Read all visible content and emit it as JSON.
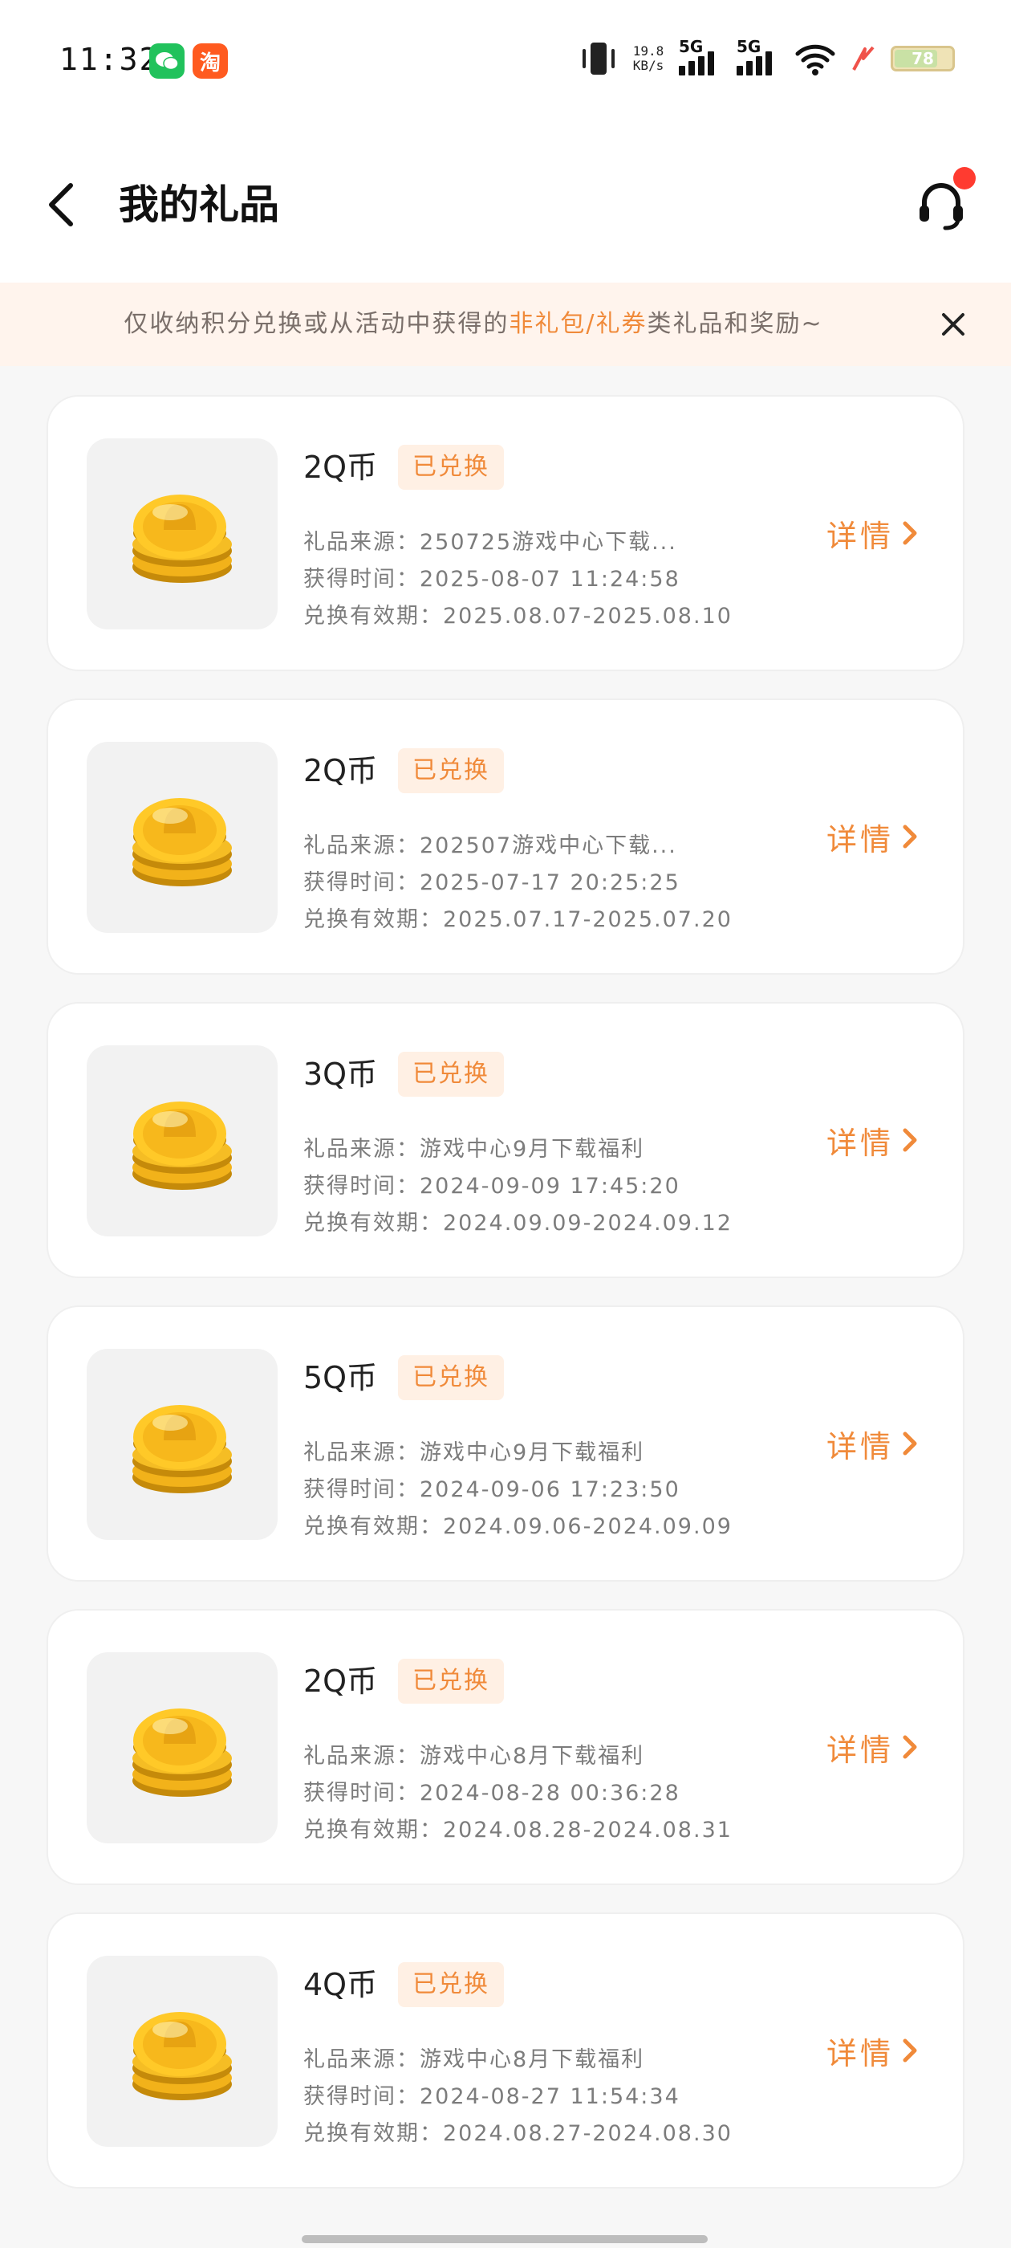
{
  "status_bar": {
    "time": "11:32",
    "net_speed_value": "19.8",
    "net_speed_unit": "KB/s",
    "sim1_label": "5G",
    "sim2_label": "5G",
    "battery_level": "78",
    "app_icons": [
      "wechat-icon",
      "taobao-icon"
    ],
    "taobao_glyph": "淘"
  },
  "header": {
    "title": "我的礼品",
    "back_icon": "chevron-left-icon",
    "support_icon": "headset-icon"
  },
  "notice": {
    "text_before": "仅收纳积分兑换或从活动中获得的",
    "text_highlight": "非礼包/礼券",
    "text_after": "类礼品和奖励~",
    "close_icon": "close-icon"
  },
  "labels": {
    "source": "礼品来源",
    "obtained": "获得时间",
    "validity": "兑换有效期",
    "colon": "：",
    "detail": "详情"
  },
  "gifts": [
    {
      "name": "2Q币",
      "status": "已兑换",
      "source": "250725游戏中心下载...",
      "obtained": "2025-08-07 11:24:58",
      "validity": "2025.08.07-2025.08.10"
    },
    {
      "name": "2Q币",
      "status": "已兑换",
      "source": "202507游戏中心下载...",
      "obtained": "2025-07-17 20:25:25",
      "validity": "2025.07.17-2025.07.20"
    },
    {
      "name": "3Q币",
      "status": "已兑换",
      "source": "游戏中心9月下载福利",
      "obtained": "2024-09-09 17:45:20",
      "validity": "2024.09.09-2024.09.12"
    },
    {
      "name": "5Q币",
      "status": "已兑换",
      "source": "游戏中心9月下载福利",
      "obtained": "2024-09-06 17:23:50",
      "validity": "2024.09.06-2024.09.09"
    },
    {
      "name": "2Q币",
      "status": "已兑换",
      "source": "游戏中心8月下载福利",
      "obtained": "2024-08-28 00:36:28",
      "validity": "2024.08.28-2024.08.31"
    },
    {
      "name": "4Q币",
      "status": "已兑换",
      "source": "游戏中心8月下载福利",
      "obtained": "2024-08-27 11:54:34",
      "validity": "2024.08.27-2024.08.30"
    }
  ],
  "colors": {
    "accent": "#f08a3a",
    "badge_bg": "#fff0e4",
    "notice_bg": "#fff4ed",
    "page_bg": "#f7f7f7",
    "notification_dot": "#ff3b30"
  }
}
